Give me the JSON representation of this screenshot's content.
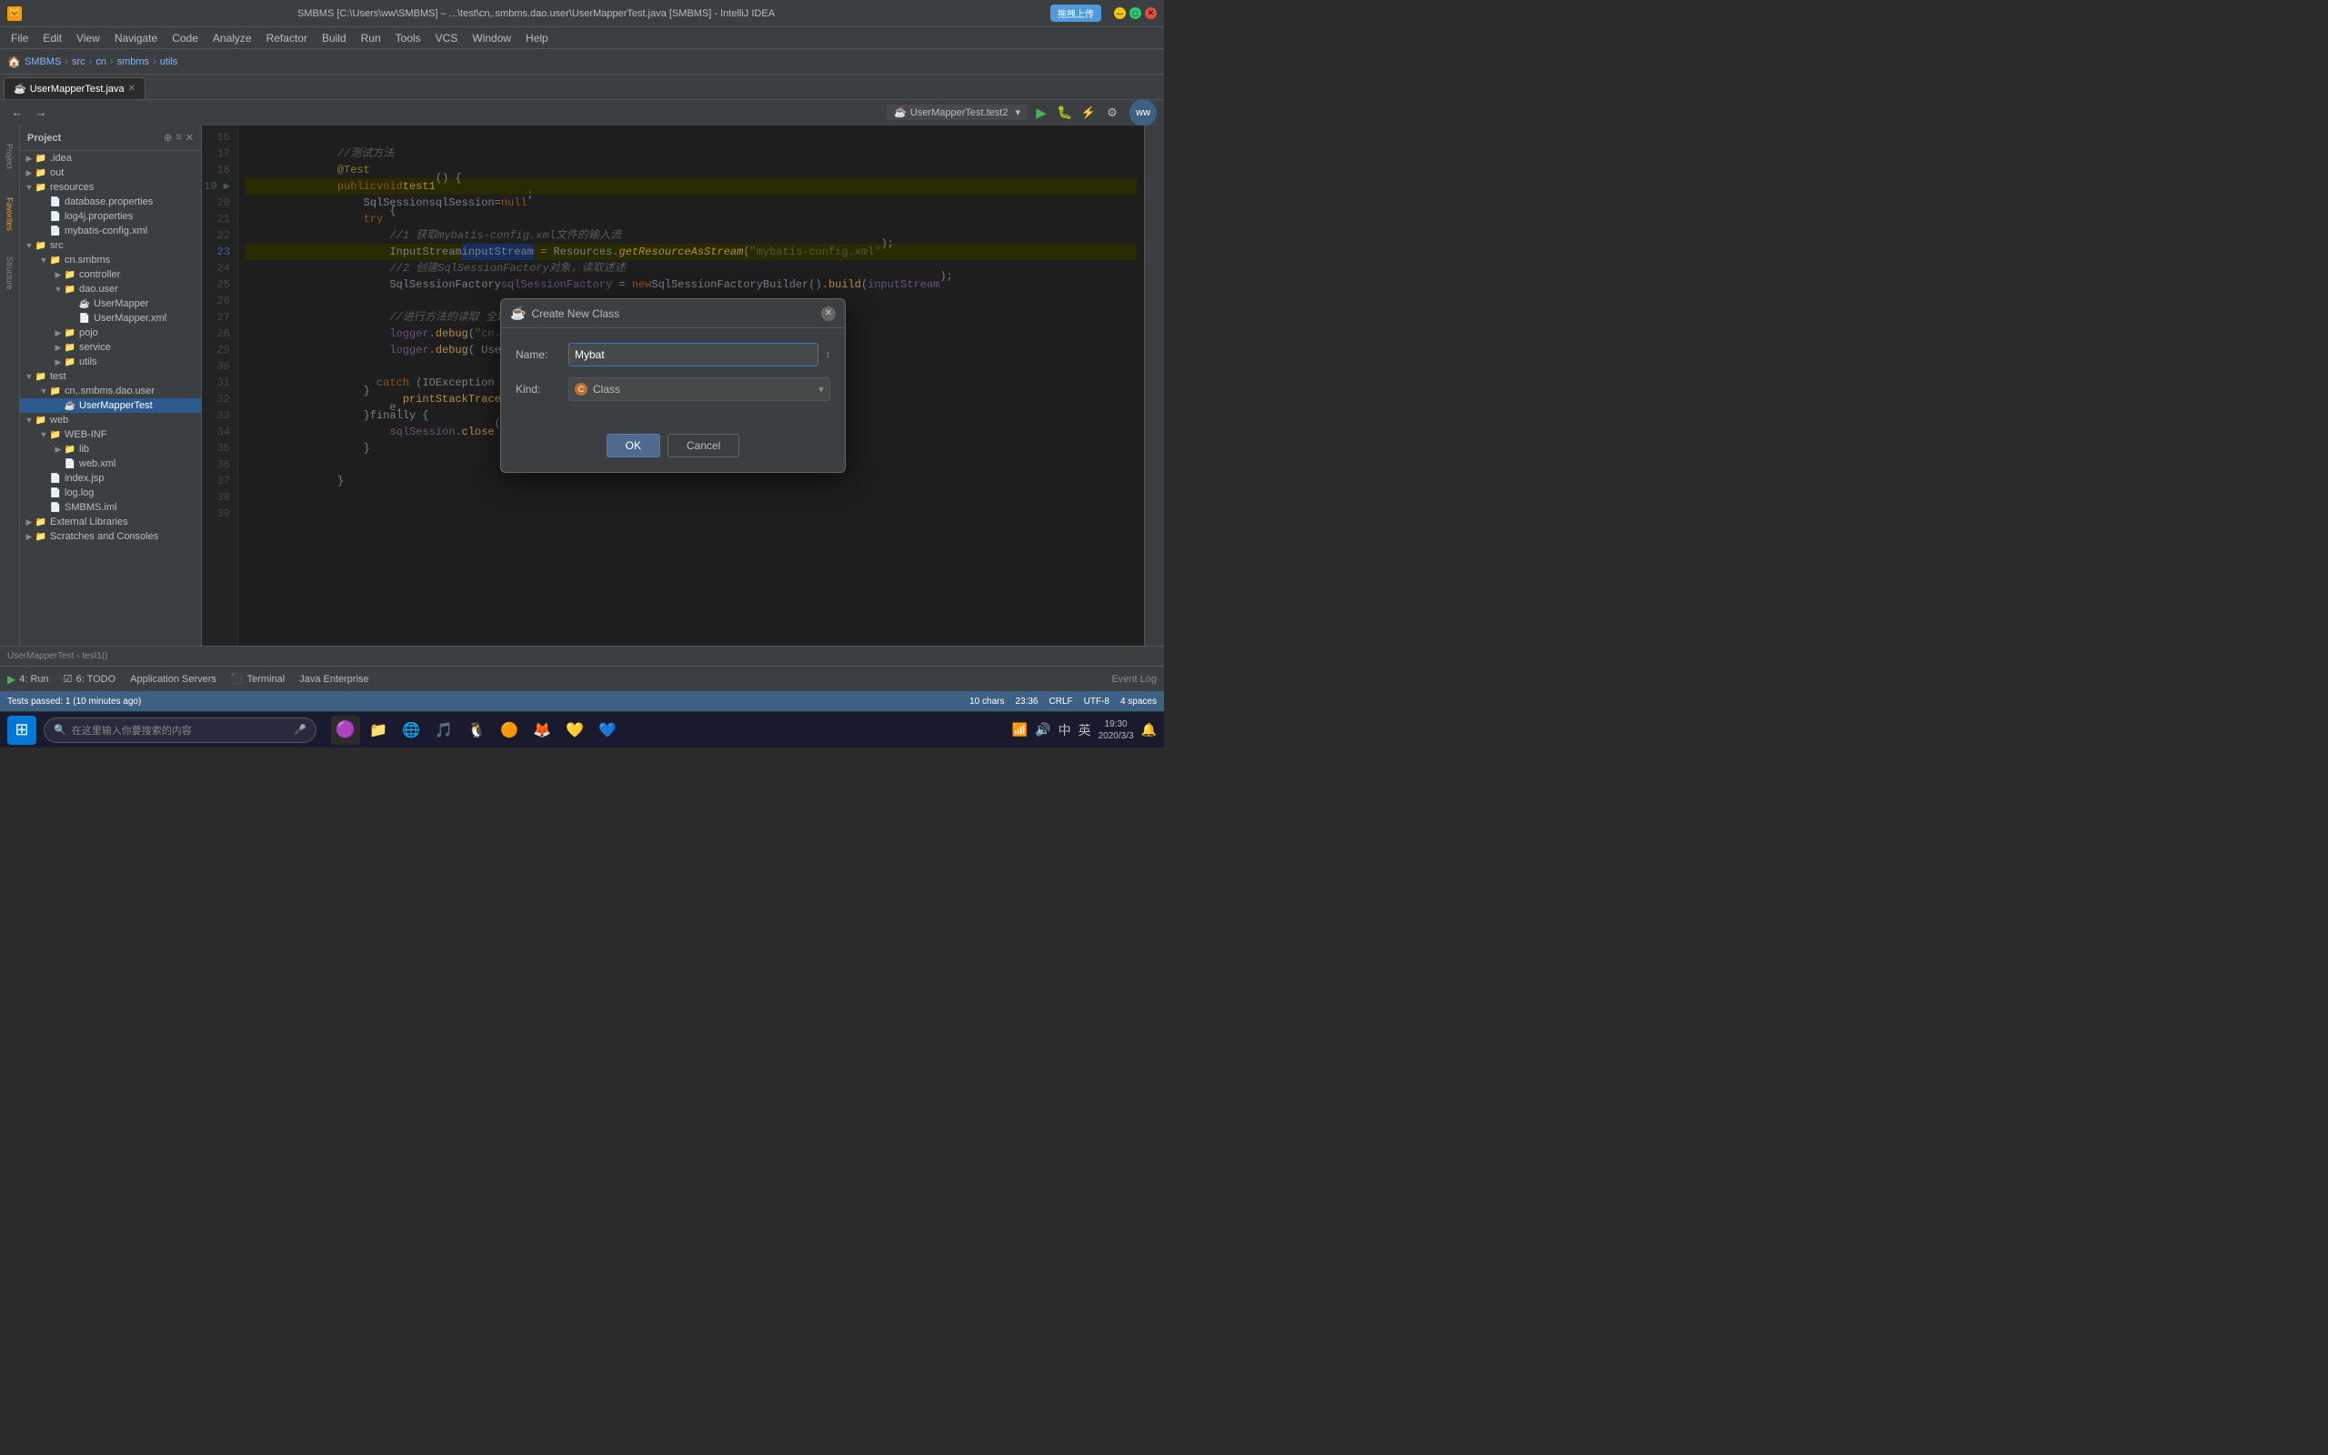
{
  "titleBar": {
    "icon": "🐱",
    "title": "SMBMS [C:\\Users\\ww\\SMBMS] – ...\\test\\cn,.smbms.dao.user\\UserMapperTest.java [SMBMS] - IntelliJ IDEA",
    "uploadBtn": "拖拽上传",
    "controls": [
      "─",
      "□",
      "✕"
    ]
  },
  "menuBar": {
    "items": [
      "File",
      "Edit",
      "View",
      "Navigate",
      "Code",
      "Analyze",
      "Refactor",
      "Build",
      "Run",
      "Tools",
      "VCS",
      "Window",
      "Help"
    ]
  },
  "breadcrumb": {
    "items": [
      "SMBMS",
      "src",
      "cn",
      "smbms",
      "utils"
    ]
  },
  "tabBar": {
    "tabs": [
      {
        "label": "UserMapperTest.java",
        "active": true
      }
    ]
  },
  "editorToolbar": {
    "runConfig": "UserMapperTest.test2"
  },
  "projectPanel": {
    "title": "Project",
    "tree": [
      {
        "depth": 4,
        "type": "folder",
        "label": ".idea",
        "expanded": false
      },
      {
        "depth": 4,
        "type": "folder",
        "label": "out",
        "expanded": false
      },
      {
        "depth": 4,
        "type": "folder",
        "label": "resources",
        "expanded": true
      },
      {
        "depth": 20,
        "type": "file",
        "label": "database.properties"
      },
      {
        "depth": 20,
        "type": "file",
        "label": "log4j.properties"
      },
      {
        "depth": 20,
        "type": "file",
        "label": "mybatis-config.xml"
      },
      {
        "depth": 4,
        "type": "folder",
        "label": "src",
        "expanded": true
      },
      {
        "depth": 20,
        "type": "folder",
        "label": "cn.smbms",
        "expanded": true
      },
      {
        "depth": 36,
        "type": "folder",
        "label": "controller",
        "expanded": false
      },
      {
        "depth": 36,
        "type": "folder",
        "label": "dao.user",
        "expanded": true
      },
      {
        "depth": 52,
        "type": "java",
        "label": "UserMapper"
      },
      {
        "depth": 52,
        "type": "java",
        "label": "UserMapper.xml"
      },
      {
        "depth": 36,
        "type": "folder",
        "label": "pojo",
        "expanded": false
      },
      {
        "depth": 36,
        "type": "folder",
        "label": "service",
        "expanded": false
      },
      {
        "depth": 36,
        "type": "folder",
        "label": "utils",
        "expanded": false
      },
      {
        "depth": 20,
        "type": "folder",
        "label": "test",
        "expanded": true
      },
      {
        "depth": 36,
        "type": "folder",
        "label": "cn,.smbms.dao.user",
        "expanded": true
      },
      {
        "depth": 52,
        "type": "java",
        "label": "UserMapperTest",
        "selected": true
      },
      {
        "depth": 4,
        "type": "folder",
        "label": "web",
        "expanded": true
      },
      {
        "depth": 20,
        "type": "folder",
        "label": "WEB-INF",
        "expanded": true
      },
      {
        "depth": 36,
        "type": "folder",
        "label": "lib",
        "expanded": false
      },
      {
        "depth": 36,
        "type": "file",
        "label": "web.xml"
      },
      {
        "depth": 20,
        "type": "file",
        "label": "index.jsp"
      },
      {
        "depth": 20,
        "type": "file",
        "label": "log.log"
      },
      {
        "depth": 20,
        "type": "file",
        "label": "SMBMS.iml"
      },
      {
        "depth": 4,
        "type": "folder",
        "label": "External Libraries",
        "expanded": false
      },
      {
        "depth": 4,
        "type": "folder",
        "label": "Scratches and Consoles",
        "expanded": false
      }
    ]
  },
  "codeEditor": {
    "lines": [
      {
        "num": 16,
        "text": ""
      },
      {
        "num": 17,
        "text": "    //测试方法",
        "type": "comment"
      },
      {
        "num": 18,
        "text": "    @Test",
        "type": "annotation"
      },
      {
        "num": 19,
        "text": "    public void test1() {",
        "highlight": true
      },
      {
        "num": 20,
        "text": "        SqlSession sqlSession=null;"
      },
      {
        "num": 21,
        "text": "        try {"
      },
      {
        "num": 22,
        "text": "            //1 获取mybatis-config.xml文件的输入流",
        "type": "comment"
      },
      {
        "num": 23,
        "text": "            InputStream inputStream = Resources.getResourceAsStream(\"mybatis-config.xml\");",
        "highlight": true
      },
      {
        "num": 24,
        "text": "            //2 创建SqlSessionFactory对象，读取述述",
        "type": "comment"
      },
      {
        "num": 25,
        "text": "            SqlSessionFactory sqlSessionFactory = new SqlSessionFactoryBuilder().build(inputStream);"
      },
      {
        "num": 26,
        "text": "            "
      },
      {
        "num": 27,
        "text": "            //进行方法的读取 全路径+方法名",
        "type": "comment"
      },
      {
        "num": 28,
        "text": "            logger.debug(\"cn.smbms.dao.user.UserMapper.count\");"
      },
      {
        "num": 29,
        "text": "            logger.debug( UserMapperTest test count, \"+count);"
      },
      {
        "num": 30,
        "text": ""
      },
      {
        "num": 31,
        "text": "        } catch (IOException e) {"
      },
      {
        "num": 32,
        "text": "            e.printStackTrace();"
      },
      {
        "num": 33,
        "text": "        }finally {"
      },
      {
        "num": 34,
        "text": "            sqlSession.close();"
      },
      {
        "num": 35,
        "text": "        }"
      },
      {
        "num": 36,
        "text": ""
      },
      {
        "num": 37,
        "text": "    }"
      },
      {
        "num": 38,
        "text": ""
      },
      {
        "num": 39,
        "text": ""
      }
    ]
  },
  "bottomBar": {
    "breadcrumb": "UserMapperTest › test1()"
  },
  "bottomToolbar": {
    "tabs": [
      {
        "icon": "▶",
        "label": "4: Run",
        "active": true
      },
      {
        "icon": "☑",
        "label": "6: TODO"
      },
      {
        "label": "Application Servers"
      },
      {
        "icon": "⬛",
        "label": "Terminal"
      },
      {
        "label": "Java Enterprise"
      }
    ]
  },
  "statusBar": {
    "left": [
      "Tests passed: 1 (10 minutes ago)"
    ],
    "right": [
      "10 chars",
      "23:36",
      "CRLF",
      "UTF-8",
      "4 spaces"
    ]
  },
  "taskbar": {
    "searchPlaceholder": "在这里输入你要搜索的内容",
    "apps": [
      "⬛",
      "📁",
      "🌐",
      "🎵",
      "🔵",
      "🟠",
      "🟣"
    ],
    "time": "19:30",
    "date": "2020/3/3"
  },
  "dialog": {
    "title": "Create New Class",
    "nameLabel": "Name:",
    "nameValue": "Mybat",
    "kindLabel": "Kind:",
    "kindValue": "Class",
    "okLabel": "OK",
    "cancelLabel": "Cancel"
  },
  "sideTabs": {
    "left": [
      "Project",
      "Favorites",
      "Structure"
    ],
    "right": []
  }
}
